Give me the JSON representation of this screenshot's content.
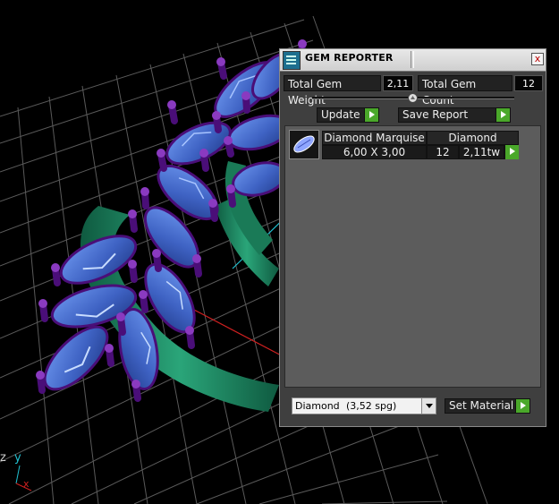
{
  "viewport": {
    "axis_labels": {
      "z": "z",
      "y": "y",
      "x": "x"
    }
  },
  "panel": {
    "title": "GEM REPORTER",
    "close_glyph": "x",
    "total_gem_weight_label": "Total Gem Weight",
    "total_gem_weight_value": "2,11",
    "total_gem_count_label": "Total Gem Count",
    "total_gem_count_value": "12",
    "update_label": "Update",
    "save_report_label": "Save Report",
    "gem_list": [
      {
        "name": "Diamond Marquise",
        "material": "Diamond",
        "size": "6,00 X 3,00",
        "count": "12",
        "weight": "2,11tw"
      }
    ],
    "material_select_name": "Diamond",
    "material_select_density": "(3,52 spg)",
    "set_material_label": "Set Material"
  },
  "icons": {
    "title_icon": "gem-reporter-icon",
    "close": "close-icon",
    "arrow": "green-arrow-icon",
    "dropdown": "chevron-down-icon"
  },
  "colors": {
    "grid": "#5a5a5a",
    "gem": "#4d76d6",
    "prong": "#6a1a9a",
    "band": "#1e8a63",
    "button_arrow": "#4aa82a",
    "axis_x": "#d02020",
    "axis_y": "#20c0d0"
  }
}
